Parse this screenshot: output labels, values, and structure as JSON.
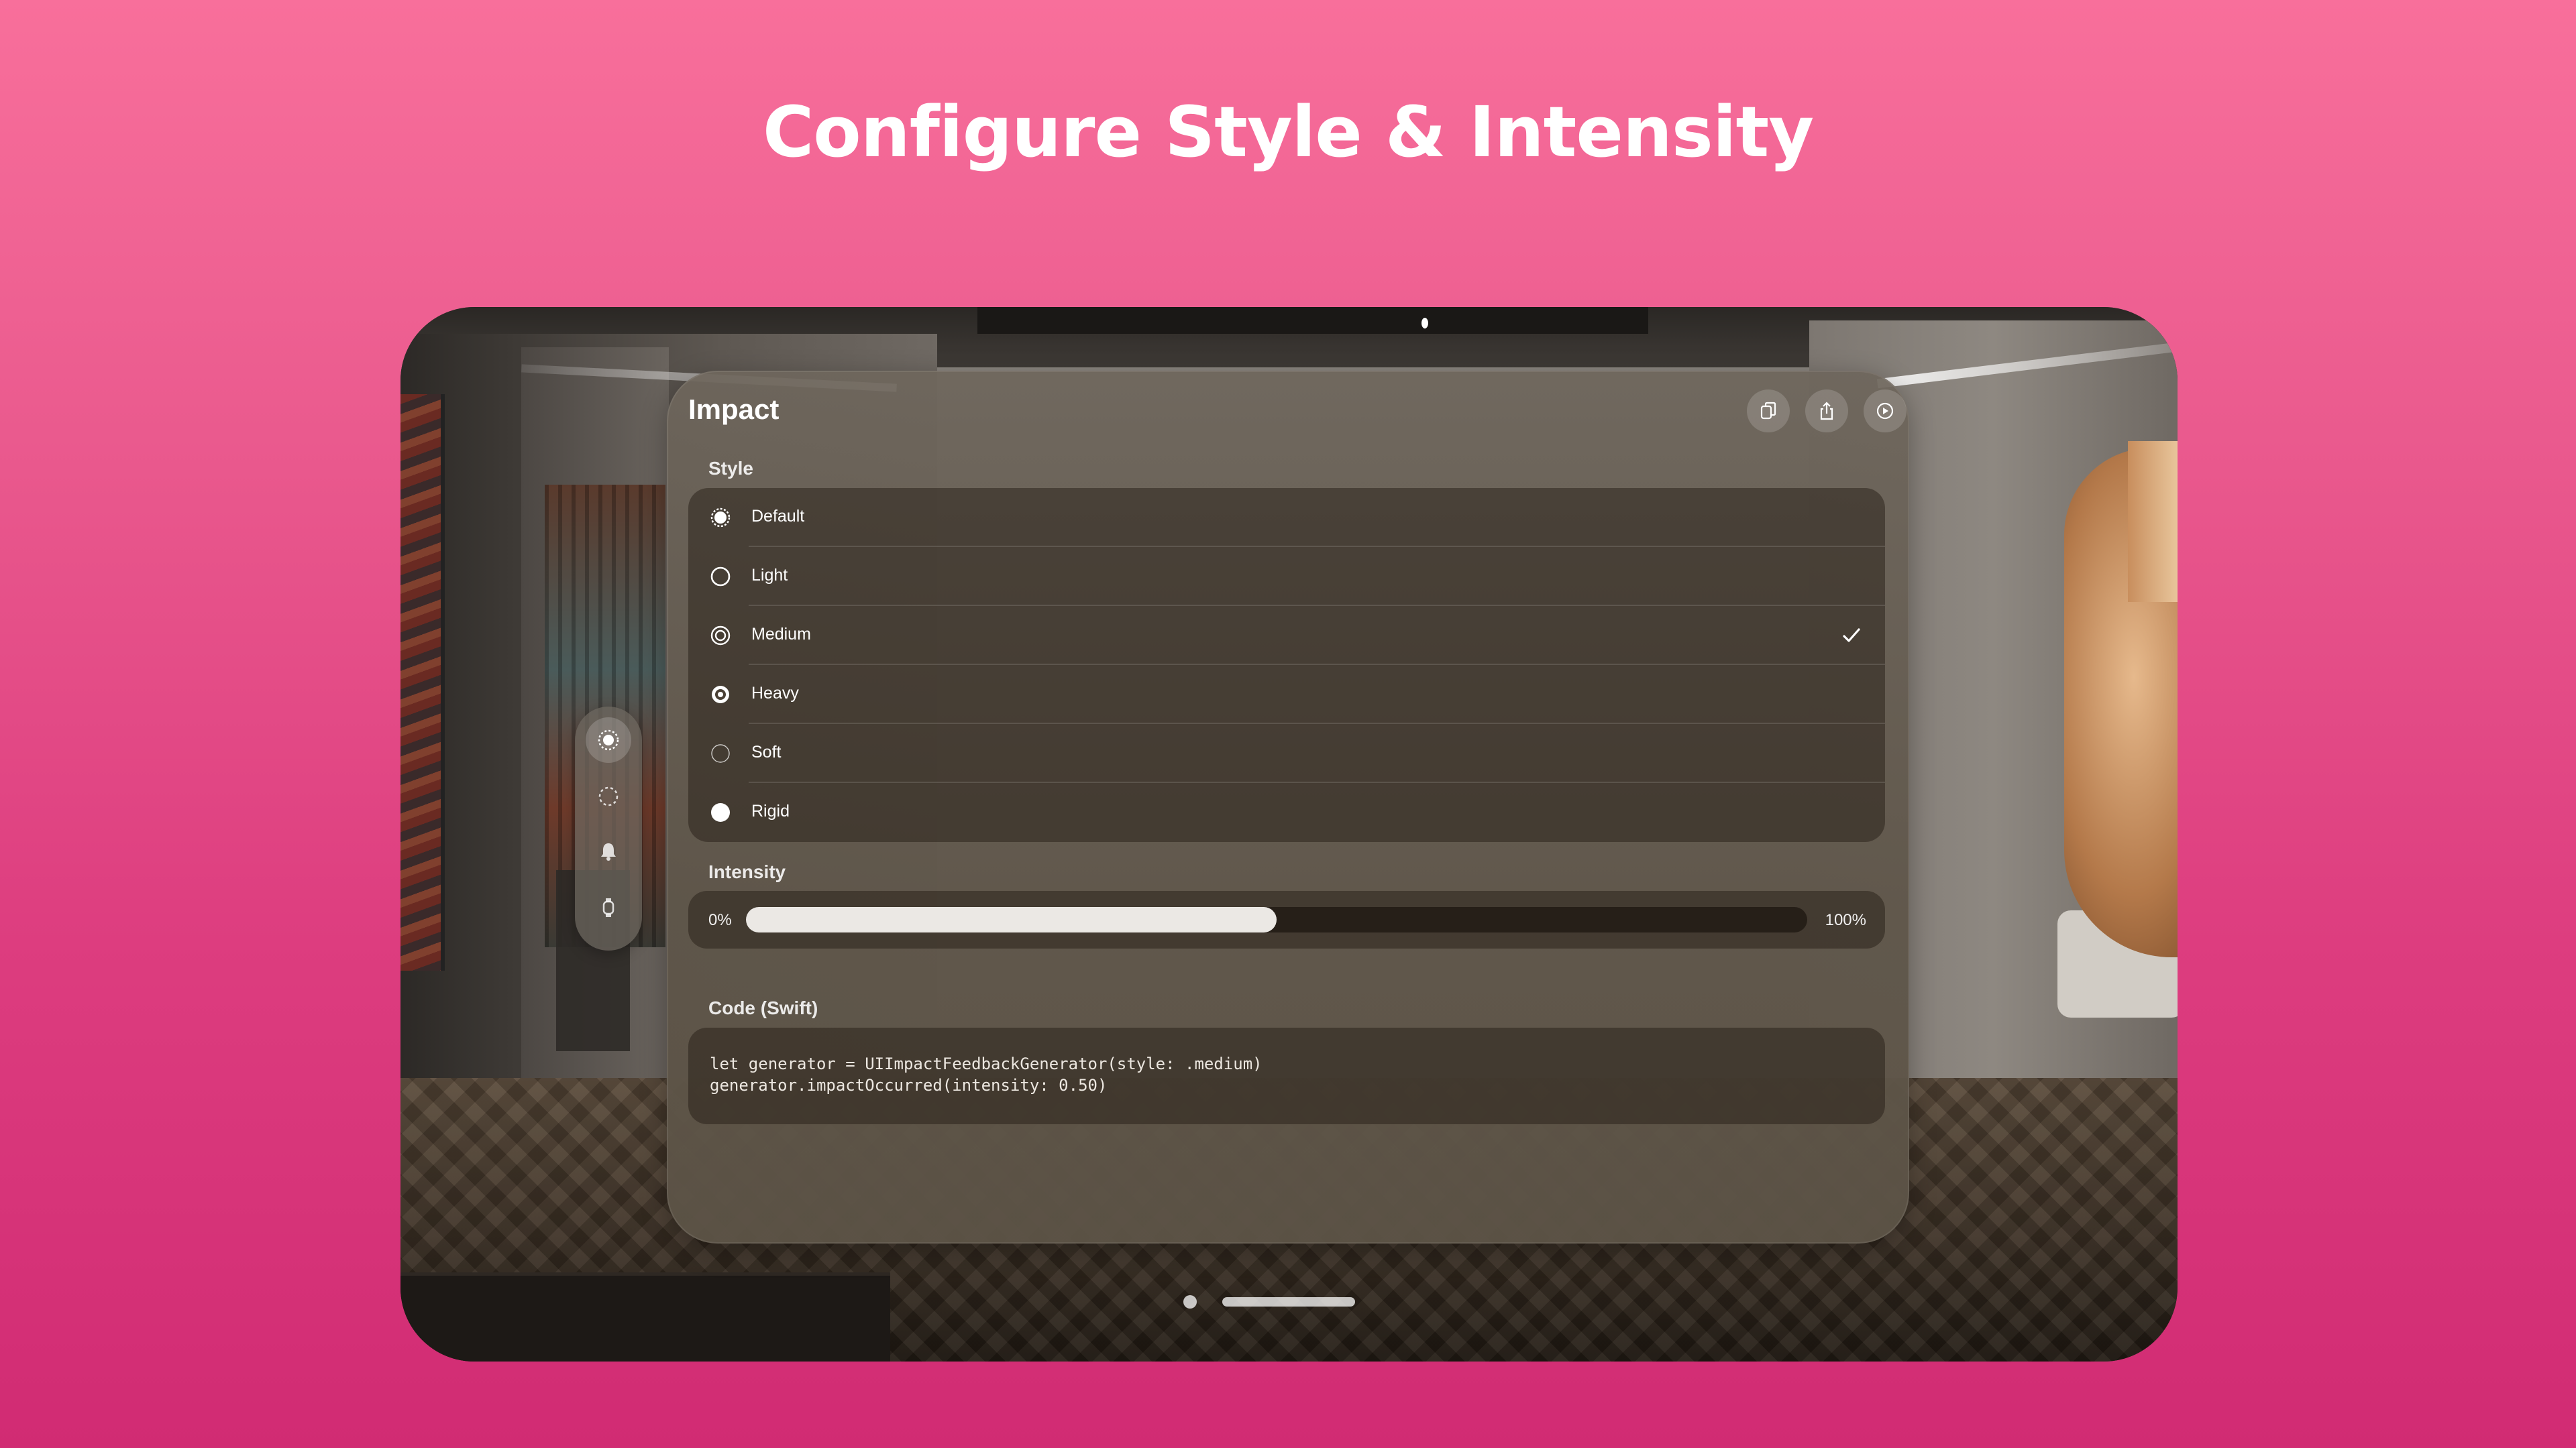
{
  "headline": "Configure Style & Intensity",
  "panel": {
    "title": "Impact",
    "toolbar": [
      {
        "icon": "copy-icon"
      },
      {
        "icon": "share-icon"
      },
      {
        "icon": "play-icon"
      }
    ]
  },
  "ornament": {
    "items": [
      {
        "icon": "impact-icon",
        "active": true
      },
      {
        "icon": "dotted-circle-icon",
        "active": false
      },
      {
        "icon": "bell-icon",
        "active": false
      },
      {
        "icon": "watch-icon",
        "active": false
      }
    ]
  },
  "style_section": {
    "label": "Style",
    "options": [
      {
        "label": "Default",
        "icon": "radio-dotted-filled-icon",
        "selected": false
      },
      {
        "label": "Light",
        "icon": "radio-empty-icon",
        "selected": false
      },
      {
        "label": "Medium",
        "icon": "radio-double-ring-icon",
        "selected": true
      },
      {
        "label": "Heavy",
        "icon": "radio-bold-dot-icon",
        "selected": false
      },
      {
        "label": "Soft",
        "icon": "radio-thin-ring-icon",
        "selected": false
      },
      {
        "label": "Rigid",
        "icon": "radio-solid-icon",
        "selected": false
      }
    ]
  },
  "intensity_section": {
    "label": "Intensity",
    "min_label": "0%",
    "max_label": "100%",
    "value": 0.5
  },
  "code_section": {
    "label": "Code (Swift)",
    "line1": "let generator = UIImpactFeedbackGenerator(style: .medium)",
    "line2": "generator.impactOccurred(intensity: 0.50)"
  },
  "pager": {
    "pages": 2,
    "current": 1
  },
  "colors": {
    "background_top": "#f86f9b",
    "background_bottom": "#d12b73",
    "slider_fill": "#ebe8e4"
  }
}
